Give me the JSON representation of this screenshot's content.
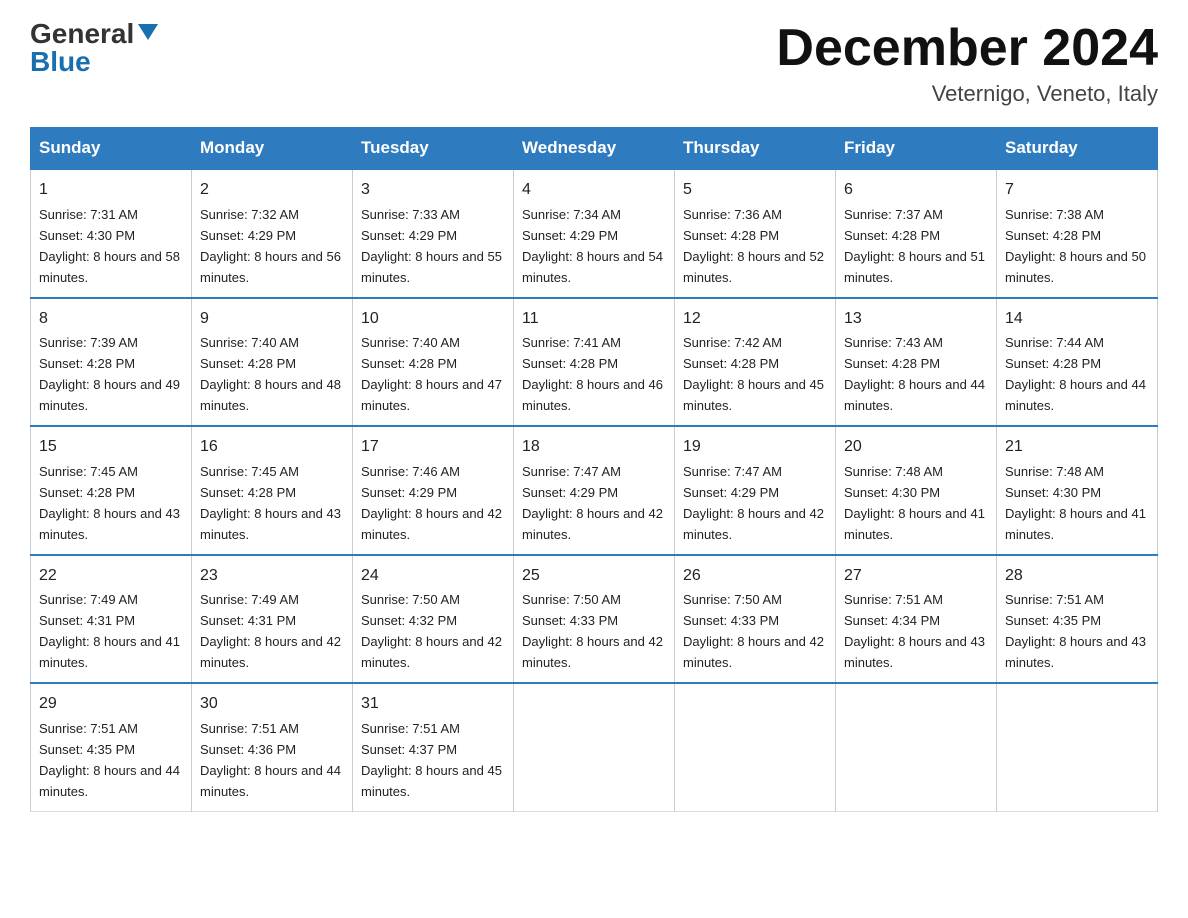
{
  "header": {
    "logo_general": "General",
    "logo_blue": "Blue",
    "month_title": "December 2024",
    "subtitle": "Veternigo, Veneto, Italy"
  },
  "weekdays": [
    "Sunday",
    "Monday",
    "Tuesday",
    "Wednesday",
    "Thursday",
    "Friday",
    "Saturday"
  ],
  "weeks": [
    [
      {
        "day": "1",
        "sunrise": "7:31 AM",
        "sunset": "4:30 PM",
        "daylight": "8 hours and 58 minutes."
      },
      {
        "day": "2",
        "sunrise": "7:32 AM",
        "sunset": "4:29 PM",
        "daylight": "8 hours and 56 minutes."
      },
      {
        "day": "3",
        "sunrise": "7:33 AM",
        "sunset": "4:29 PM",
        "daylight": "8 hours and 55 minutes."
      },
      {
        "day": "4",
        "sunrise": "7:34 AM",
        "sunset": "4:29 PM",
        "daylight": "8 hours and 54 minutes."
      },
      {
        "day": "5",
        "sunrise": "7:36 AM",
        "sunset": "4:28 PM",
        "daylight": "8 hours and 52 minutes."
      },
      {
        "day": "6",
        "sunrise": "7:37 AM",
        "sunset": "4:28 PM",
        "daylight": "8 hours and 51 minutes."
      },
      {
        "day": "7",
        "sunrise": "7:38 AM",
        "sunset": "4:28 PM",
        "daylight": "8 hours and 50 minutes."
      }
    ],
    [
      {
        "day": "8",
        "sunrise": "7:39 AM",
        "sunset": "4:28 PM",
        "daylight": "8 hours and 49 minutes."
      },
      {
        "day": "9",
        "sunrise": "7:40 AM",
        "sunset": "4:28 PM",
        "daylight": "8 hours and 48 minutes."
      },
      {
        "day": "10",
        "sunrise": "7:40 AM",
        "sunset": "4:28 PM",
        "daylight": "8 hours and 47 minutes."
      },
      {
        "day": "11",
        "sunrise": "7:41 AM",
        "sunset": "4:28 PM",
        "daylight": "8 hours and 46 minutes."
      },
      {
        "day": "12",
        "sunrise": "7:42 AM",
        "sunset": "4:28 PM",
        "daylight": "8 hours and 45 minutes."
      },
      {
        "day": "13",
        "sunrise": "7:43 AM",
        "sunset": "4:28 PM",
        "daylight": "8 hours and 44 minutes."
      },
      {
        "day": "14",
        "sunrise": "7:44 AM",
        "sunset": "4:28 PM",
        "daylight": "8 hours and 44 minutes."
      }
    ],
    [
      {
        "day": "15",
        "sunrise": "7:45 AM",
        "sunset": "4:28 PM",
        "daylight": "8 hours and 43 minutes."
      },
      {
        "day": "16",
        "sunrise": "7:45 AM",
        "sunset": "4:28 PM",
        "daylight": "8 hours and 43 minutes."
      },
      {
        "day": "17",
        "sunrise": "7:46 AM",
        "sunset": "4:29 PM",
        "daylight": "8 hours and 42 minutes."
      },
      {
        "day": "18",
        "sunrise": "7:47 AM",
        "sunset": "4:29 PM",
        "daylight": "8 hours and 42 minutes."
      },
      {
        "day": "19",
        "sunrise": "7:47 AM",
        "sunset": "4:29 PM",
        "daylight": "8 hours and 42 minutes."
      },
      {
        "day": "20",
        "sunrise": "7:48 AM",
        "sunset": "4:30 PM",
        "daylight": "8 hours and 41 minutes."
      },
      {
        "day": "21",
        "sunrise": "7:48 AM",
        "sunset": "4:30 PM",
        "daylight": "8 hours and 41 minutes."
      }
    ],
    [
      {
        "day": "22",
        "sunrise": "7:49 AM",
        "sunset": "4:31 PM",
        "daylight": "8 hours and 41 minutes."
      },
      {
        "day": "23",
        "sunrise": "7:49 AM",
        "sunset": "4:31 PM",
        "daylight": "8 hours and 42 minutes."
      },
      {
        "day": "24",
        "sunrise": "7:50 AM",
        "sunset": "4:32 PM",
        "daylight": "8 hours and 42 minutes."
      },
      {
        "day": "25",
        "sunrise": "7:50 AM",
        "sunset": "4:33 PM",
        "daylight": "8 hours and 42 minutes."
      },
      {
        "day": "26",
        "sunrise": "7:50 AM",
        "sunset": "4:33 PM",
        "daylight": "8 hours and 42 minutes."
      },
      {
        "day": "27",
        "sunrise": "7:51 AM",
        "sunset": "4:34 PM",
        "daylight": "8 hours and 43 minutes."
      },
      {
        "day": "28",
        "sunrise": "7:51 AM",
        "sunset": "4:35 PM",
        "daylight": "8 hours and 43 minutes."
      }
    ],
    [
      {
        "day": "29",
        "sunrise": "7:51 AM",
        "sunset": "4:35 PM",
        "daylight": "8 hours and 44 minutes."
      },
      {
        "day": "30",
        "sunrise": "7:51 AM",
        "sunset": "4:36 PM",
        "daylight": "8 hours and 44 minutes."
      },
      {
        "day": "31",
        "sunrise": "7:51 AM",
        "sunset": "4:37 PM",
        "daylight": "8 hours and 45 minutes."
      },
      null,
      null,
      null,
      null
    ]
  ]
}
